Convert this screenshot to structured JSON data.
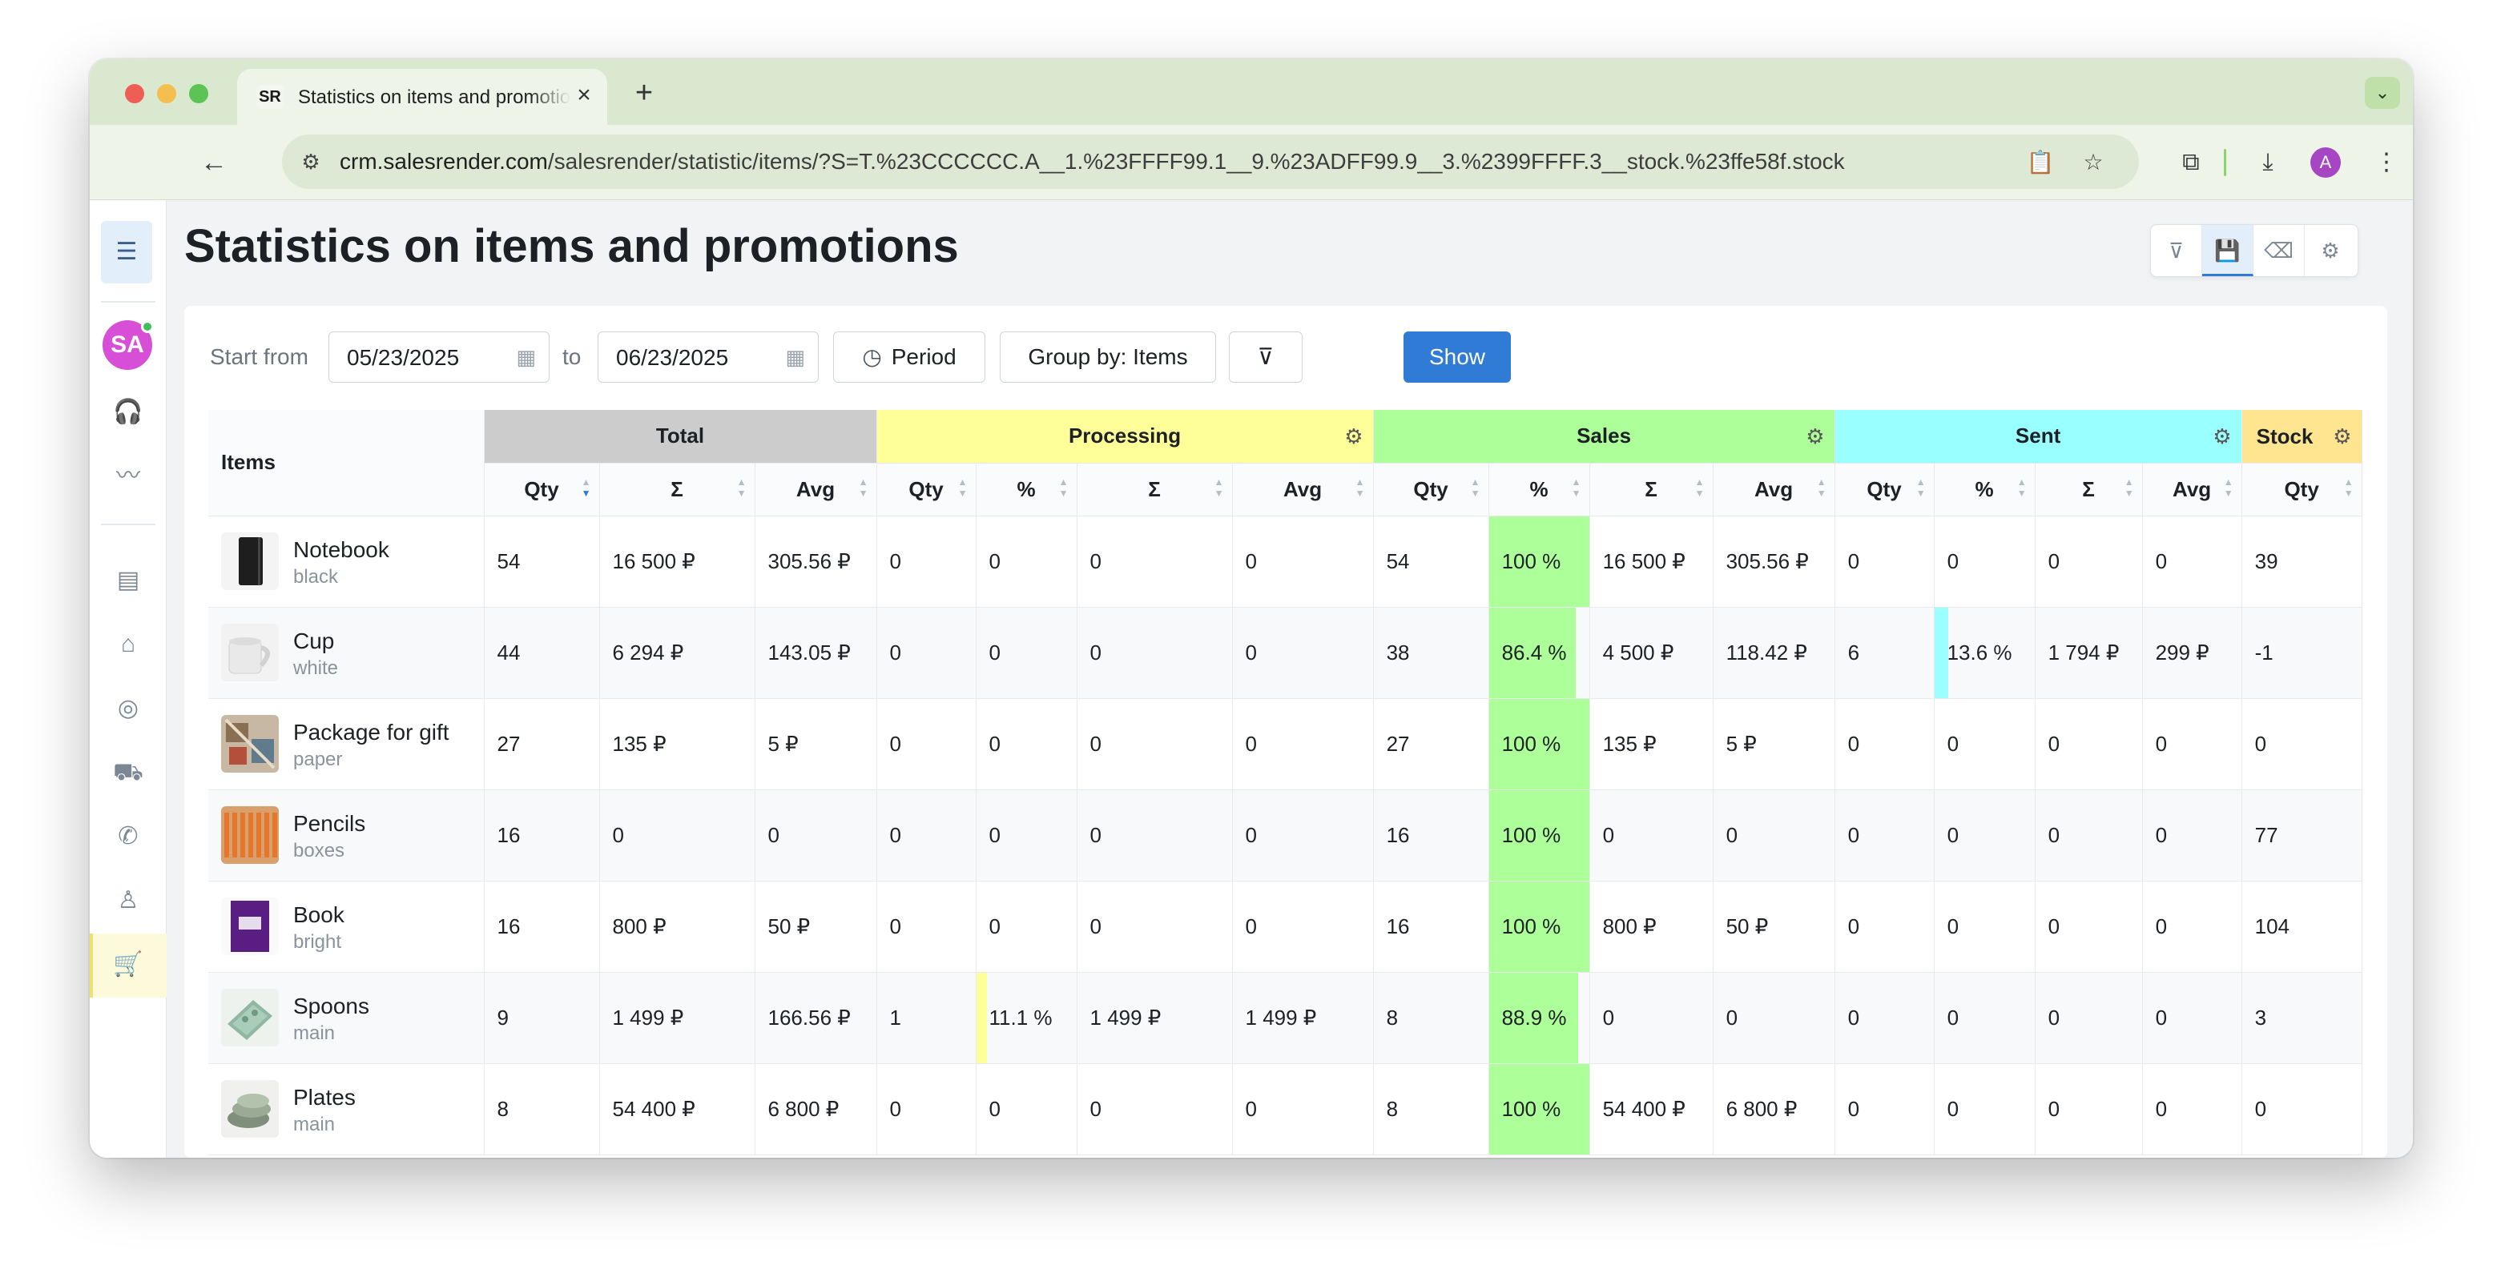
{
  "browser": {
    "tab_title": "Statistics on items and promotions",
    "tab_favicon": "SR",
    "new_tab": "+",
    "url_host": "crm.salesrender.com",
    "url_path": "/salesrender/statistic/items/?S=T.%23CCCCCC.A__1.%23FFFF99.1__9.%23ADFF99.9__3.%2399FFFF.3__stock.%23ffe58f.stock",
    "profile_initial": "A"
  },
  "sidebar": {
    "avatar": "SA",
    "icons": [
      "headset-icon",
      "analytics-icon",
      "statistics-icon",
      "store-icon",
      "target-icon",
      "delivery-truck-icon",
      "phone-icon",
      "user-icon",
      "cart-icon"
    ]
  },
  "page": {
    "title": "Statistics on items and promotions"
  },
  "filters": {
    "start_label": "Start from",
    "start_date": "05/23/2025",
    "to_label": "to",
    "end_date": "06/23/2025",
    "period_label": "Period",
    "group_label": "Group by: Items",
    "show_label": "Show"
  },
  "table": {
    "items_header": "Items",
    "groups": [
      {
        "name": "Total",
        "color": "#cccccc"
      },
      {
        "name": "Processing",
        "color": "#ffff99"
      },
      {
        "name": "Sales",
        "color": "#adff99"
      },
      {
        "name": "Sent",
        "color": "#99ffff"
      },
      {
        "name": "Stock",
        "color": "#ffe58f"
      }
    ],
    "subheaders": [
      "Qty",
      "Σ",
      "Avg",
      "Qty",
      "%",
      "Σ",
      "Avg",
      "Qty",
      "%",
      "Σ",
      "Avg",
      "Qty",
      "%",
      "Σ",
      "Avg",
      "Qty"
    ],
    "rows": [
      {
        "name": "Notebook",
        "variant": "black",
        "total_qty": "54",
        "total_sum": "16 500 ₽",
        "total_avg": "305.56 ₽",
        "proc_qty": "0",
        "proc_pct": "0",
        "proc_pct_value": 0,
        "proc_sum": "0",
        "proc_avg": "0",
        "sales_qty": "54",
        "sales_pct": "100 %",
        "sales_pct_value": 100,
        "sales_sum": "16 500 ₽",
        "sales_avg": "305.56 ₽",
        "sent_qty": "0",
        "sent_pct": "0",
        "sent_pct_value": 0,
        "sent_sum": "0",
        "sent_avg": "0",
        "stock_qty": "39"
      },
      {
        "name": "Cup",
        "variant": "white",
        "total_qty": "44",
        "total_sum": "6 294 ₽",
        "total_avg": "143.05 ₽",
        "proc_qty": "0",
        "proc_pct": "0",
        "proc_pct_value": 0,
        "proc_sum": "0",
        "proc_avg": "0",
        "sales_qty": "38",
        "sales_pct": "86.4 %",
        "sales_pct_value": 86.4,
        "sales_sum": "4 500 ₽",
        "sales_avg": "118.42 ₽",
        "sent_qty": "6",
        "sent_pct": "13.6 %",
        "sent_pct_value": 13.6,
        "sent_sum": "1 794 ₽",
        "sent_avg": "299 ₽",
        "stock_qty": "-1"
      },
      {
        "name": "Package for gift",
        "variant": "paper",
        "total_qty": "27",
        "total_sum": "135 ₽",
        "total_avg": "5 ₽",
        "proc_qty": "0",
        "proc_pct": "0",
        "proc_pct_value": 0,
        "proc_sum": "0",
        "proc_avg": "0",
        "sales_qty": "27",
        "sales_pct": "100 %",
        "sales_pct_value": 100,
        "sales_sum": "135 ₽",
        "sales_avg": "5 ₽",
        "sent_qty": "0",
        "sent_pct": "0",
        "sent_pct_value": 0,
        "sent_sum": "0",
        "sent_avg": "0",
        "stock_qty": "0"
      },
      {
        "name": "Pencils",
        "variant": "boxes",
        "total_qty": "16",
        "total_sum": "0",
        "total_avg": "0",
        "proc_qty": "0",
        "proc_pct": "0",
        "proc_pct_value": 0,
        "proc_sum": "0",
        "proc_avg": "0",
        "sales_qty": "16",
        "sales_pct": "100 %",
        "sales_pct_value": 100,
        "sales_sum": "0",
        "sales_avg": "0",
        "sent_qty": "0",
        "sent_pct": "0",
        "sent_pct_value": 0,
        "sent_sum": "0",
        "sent_avg": "0",
        "stock_qty": "77"
      },
      {
        "name": "Book",
        "variant": "bright",
        "total_qty": "16",
        "total_sum": "800 ₽",
        "total_avg": "50 ₽",
        "proc_qty": "0",
        "proc_pct": "0",
        "proc_pct_value": 0,
        "proc_sum": "0",
        "proc_avg": "0",
        "sales_qty": "16",
        "sales_pct": "100 %",
        "sales_pct_value": 100,
        "sales_sum": "800 ₽",
        "sales_avg": "50 ₽",
        "sent_qty": "0",
        "sent_pct": "0",
        "sent_pct_value": 0,
        "sent_sum": "0",
        "sent_avg": "0",
        "stock_qty": "104"
      },
      {
        "name": "Spoons",
        "variant": "main",
        "total_qty": "9",
        "total_sum": "1 499 ₽",
        "total_avg": "166.56 ₽",
        "proc_qty": "1",
        "proc_pct": "11.1 %",
        "proc_pct_value": 11.1,
        "proc_sum": "1 499 ₽",
        "proc_avg": "1 499 ₽",
        "sales_qty": "8",
        "sales_pct": "88.9 %",
        "sales_pct_value": 88.9,
        "sales_sum": "0",
        "sales_avg": "0",
        "sent_qty": "0",
        "sent_pct": "0",
        "sent_pct_value": 0,
        "sent_sum": "0",
        "sent_avg": "0",
        "stock_qty": "3"
      },
      {
        "name": "Plates",
        "variant": "main",
        "total_qty": "8",
        "total_sum": "54 400 ₽",
        "total_avg": "6 800 ₽",
        "proc_qty": "0",
        "proc_pct": "0",
        "proc_pct_value": 0,
        "proc_sum": "0",
        "proc_avg": "0",
        "sales_qty": "8",
        "sales_pct": "100 %",
        "sales_pct_value": 100,
        "sales_sum": "54 400 ₽",
        "sales_avg": "6 800 ₽",
        "sent_qty": "0",
        "sent_pct": "0",
        "sent_pct_value": 0,
        "sent_sum": "0",
        "sent_avg": "0",
        "stock_qty": "0"
      }
    ]
  }
}
